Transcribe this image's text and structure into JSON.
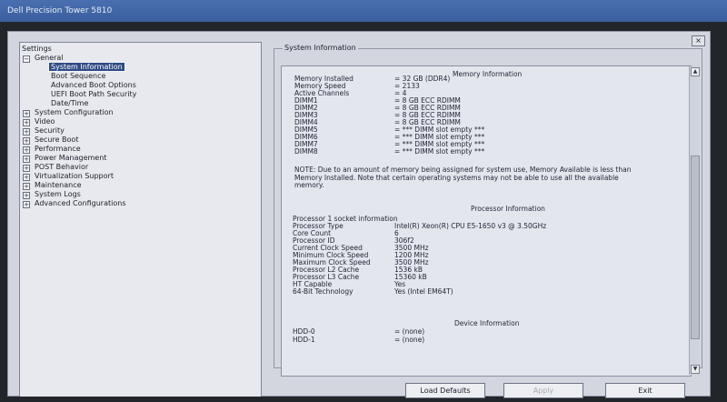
{
  "titlebar": {
    "title": "Dell Precision Tower 5810"
  },
  "window": {
    "close_symbol": "×"
  },
  "tree": {
    "root": "Settings",
    "general": {
      "label": "General",
      "children": [
        "System Information",
        "Boot Sequence",
        "Advanced Boot Options",
        "UEFI Boot Path Security",
        "Date/Time"
      ],
      "selected": "System Information"
    },
    "categories": [
      "System Configuration",
      "Video",
      "Security",
      "Secure Boot",
      "Performance",
      "Power Management",
      "POST Behavior",
      "Virtualization Support",
      "Maintenance",
      "System Logs",
      "Advanced Configurations"
    ],
    "expand_symbol": "+",
    "collapse_symbol": "−"
  },
  "info": {
    "group_label": "System Information",
    "memory": {
      "heading": "Memory Information",
      "rows": [
        {
          "label": "Memory Installed",
          "value": "= 32 GB (DDR4)"
        },
        {
          "label": "Memory Speed",
          "value": "= 2133"
        },
        {
          "label": "Active Channels",
          "value": "= 4"
        },
        {
          "label": "DIMM1",
          "value": "= 8 GB ECC RDIMM"
        },
        {
          "label": "DIMM2",
          "value": "= 8 GB ECC RDIMM"
        },
        {
          "label": "DIMM3",
          "value": "= 8 GB ECC RDIMM"
        },
        {
          "label": "DIMM4",
          "value": "= 8 GB ECC RDIMM"
        },
        {
          "label": "DIMM5",
          "value": "= *** DIMM slot empty ***"
        },
        {
          "label": "DIMM6",
          "value": "= *** DIMM slot empty ***"
        },
        {
          "label": "DIMM7",
          "value": "= *** DIMM slot empty ***"
        },
        {
          "label": "DIMM8",
          "value": "= *** DIMM slot empty ***"
        }
      ],
      "note": "NOTE: Due to an amount of memory being assigned for system use, Memory Available is less than Memory Installed. Note that certain operating systems may not be able to use all the available memory."
    },
    "processor": {
      "heading": "Processor Information",
      "rows": [
        {
          "label": "Processor 1 socket information",
          "value": ""
        },
        {
          "label": "Processor Type",
          "value": "Intel(R) Xeon(R) CPU E5-1650 v3 @ 3.50GHz"
        },
        {
          "label": "Core Count",
          "value": "6"
        },
        {
          "label": "Processor ID",
          "value": "306f2"
        },
        {
          "label": "Current Clock Speed",
          "value": "3500 MHz"
        },
        {
          "label": "Minimum Clock Speed",
          "value": "1200 MHz"
        },
        {
          "label": "Maximum Clock Speed",
          "value": "3500 MHz"
        },
        {
          "label": "Processor L2 Cache",
          "value": "1536 kB"
        },
        {
          "label": "Processor L3 Cache",
          "value": "15360 kB"
        },
        {
          "label": "HT Capable",
          "value": "Yes"
        },
        {
          "label": "64-Bit Technology",
          "value": "Yes (Intel EM64T)"
        }
      ]
    },
    "device": {
      "heading": "Device Information",
      "rows": [
        {
          "label": "HDD-0",
          "value": "= (none)"
        },
        {
          "label": "HDD-1",
          "value": "= (none)"
        }
      ]
    }
  },
  "scrollbar": {
    "up_symbol": "▲",
    "down_symbol": "▼"
  },
  "buttons": {
    "load_defaults": "Load Defaults",
    "apply": "Apply",
    "exit": "Exit"
  }
}
